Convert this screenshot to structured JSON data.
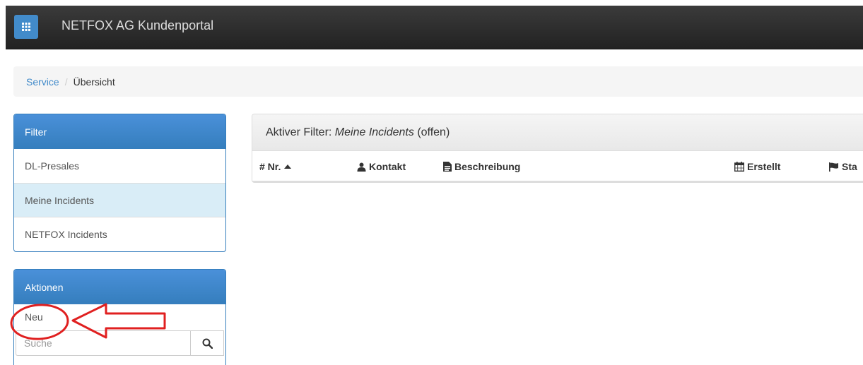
{
  "navbar": {
    "apps_icon": "grid-icon",
    "brand": "NETFOX AG Kundenportal",
    "color": "#2b2b2b",
    "accent": "#428bca"
  },
  "breadcrumb": {
    "items": [
      "Service",
      "Übersicht"
    ],
    "separator": "/"
  },
  "filter_panel": {
    "title": "Filter",
    "items": [
      "DL-Presales",
      "Meine Incidents",
      "NETFOX Incidents"
    ],
    "active_item": "Meine Incidents"
  },
  "actions_panel": {
    "title": "Aktionen",
    "new_label": "Neu",
    "search_placeholder": "Suche",
    "search_icon": "search-icon"
  },
  "main_panel": {
    "heading_prefix": "Aktiver Filter:",
    "heading_filter": "Meine Incidents",
    "heading_suffix": "(offen)",
    "columns": [
      {
        "label": "# Nr.",
        "icon": "sort-asc-icon"
      },
      {
        "label": "Kontakt",
        "icon": "user-icon"
      },
      {
        "label": "Beschreibung",
        "icon": "file-icon"
      },
      {
        "label": "Erstellt",
        "icon": "calendar-icon"
      },
      {
        "label": "Sta",
        "icon": "flag-icon"
      }
    ]
  },
  "annotation": {
    "color": "#e02020",
    "shapes": [
      "circle-highlight",
      "arrow-left"
    ]
  }
}
